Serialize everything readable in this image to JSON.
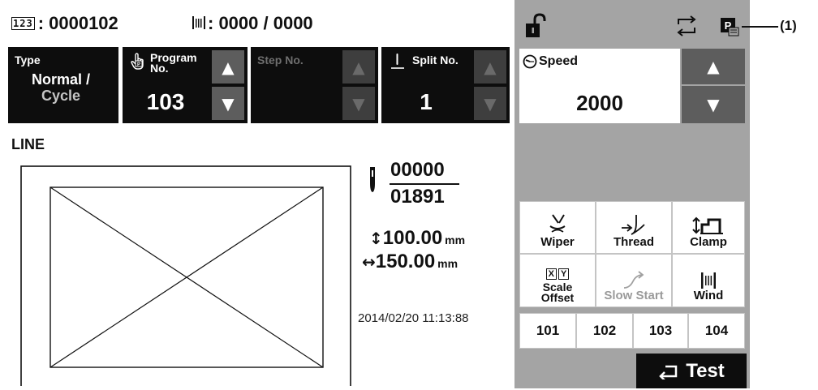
{
  "header": {
    "counter_badge": "123",
    "counter_value": ": 0000102",
    "bobbin_value": ": 0000 / 0000"
  },
  "program_boxes": {
    "type_title": "Type",
    "type_value_line1": "Normal /",
    "type_value_line2": "Cycle",
    "program_title_line1": "Program",
    "program_title_line2": "No.",
    "program_value": "103",
    "step_title": "Step No.",
    "split_title": "Split No.",
    "split_value": "1"
  },
  "pattern": {
    "shape_label": "LINE",
    "stitch_current": "00000",
    "stitch_total": "01891",
    "height_value": "100.00",
    "width_value": "150.00",
    "unit": "mm",
    "datetime": "2014/02/20 11:13:88"
  },
  "speed": {
    "label": "Speed",
    "value": "2000"
  },
  "functions": {
    "wiper": "Wiper",
    "thread": "Thread",
    "clamp": "Clamp",
    "scale_line1": "Scale",
    "scale_line2": "Offset",
    "slow_start": "Slow Start",
    "wind": "Wind"
  },
  "program_shortcuts": [
    "101",
    "102",
    "103",
    "104"
  ],
  "test_button": "Test",
  "callout": "(1)",
  "status_icons": [
    "unlock-icon",
    "cycle-arrows-icon",
    "p-memory-icon"
  ]
}
